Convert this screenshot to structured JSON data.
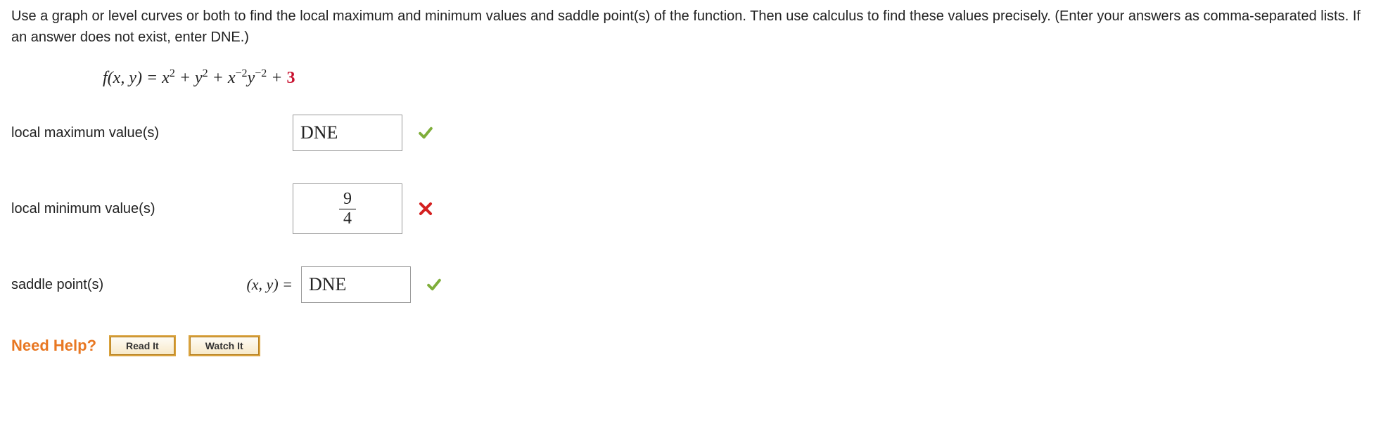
{
  "instructions": "Use a graph or level curves or both to find the local maximum and minimum values and saddle point(s) of the function. Then use calculus to find these values precisely. (Enter your answers as comma-separated lists. If an answer does not exist, enter DNE.)",
  "equation": {
    "lhs": "f(x, y) = ",
    "term1_base": "x",
    "term1_exp": "2",
    "plus1": " + ",
    "term2_base": "y",
    "term2_exp": "2",
    "plus2": " + ",
    "term3_base": "x",
    "term3_exp": "−2",
    "term4_base": "y",
    "term4_exp": "−2",
    "plus3": " + ",
    "constant": "3"
  },
  "rows": {
    "localmax": {
      "label": "local maximum value(s)",
      "prefix": "",
      "value": "DNE",
      "feedback": "correct"
    },
    "localmin": {
      "label": "local minimum value(s)",
      "prefix": "",
      "numerator": "9",
      "denominator": "4",
      "feedback": "incorrect"
    },
    "saddle": {
      "label": "saddle point(s)",
      "prefix": "(x, y)  = ",
      "value": "DNE",
      "feedback": "correct"
    }
  },
  "needHelp": {
    "label": "Need Help?",
    "readIt": "Read It",
    "watchIt": "Watch It"
  }
}
